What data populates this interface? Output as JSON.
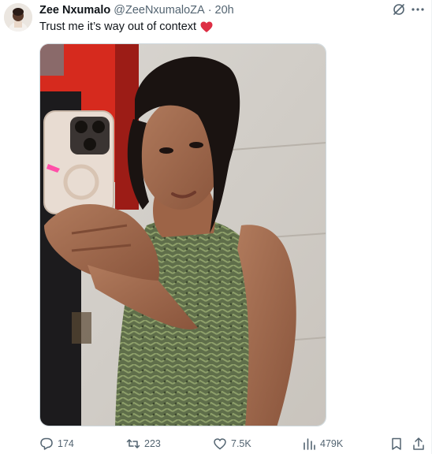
{
  "tweet": {
    "display_name": "Zee Nxumalo",
    "handle": "@ZeeNxumaloZA",
    "separator": "·",
    "time": "20h",
    "text": "Trust me it’s way out of context"
  },
  "actions": {
    "reply_count": "174",
    "repost_count": "223",
    "like_count": "7.5K",
    "view_count": "479K"
  },
  "colors": {
    "text_primary": "#0f1419",
    "text_secondary": "#536471",
    "heart": "#e0245e",
    "border": "#cfd9de"
  },
  "icons": {
    "grok": "grok-icon",
    "more": "more-icon",
    "reply": "reply-icon",
    "repost": "repost-icon",
    "like": "heart-icon",
    "views": "analytics-icon",
    "bookmark": "bookmark-icon",
    "share": "share-icon"
  }
}
